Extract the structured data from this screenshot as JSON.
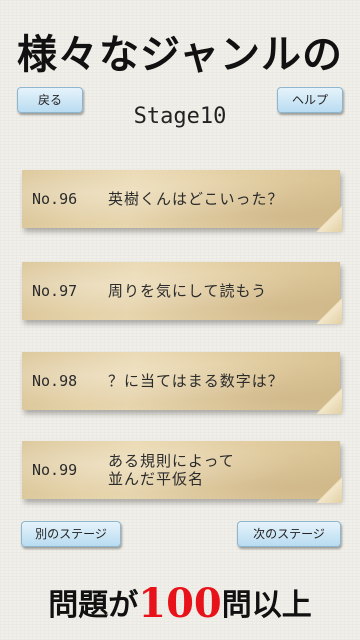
{
  "headline": "様々なジャンルの",
  "nav": {
    "back_label": "戻る",
    "help_label": "ヘルプ"
  },
  "stage_title": "Stage10",
  "questions": [
    {
      "number": "No.96",
      "title": "英樹くんはどこいった？"
    },
    {
      "number": "No.97",
      "title": "周りを気にして読もう"
    },
    {
      "number": "No.98",
      "title": "？に当てはまる数字は？"
    },
    {
      "number": "No.99",
      "title_line1": "ある規則によって",
      "title_line2": "並んだ平仮名"
    }
  ],
  "stage_nav": {
    "other_stage_label": "別のステージ",
    "next_stage_label": "次のステージ"
  },
  "footer": {
    "prefix": "問題が",
    "count": "100",
    "suffix": "問以上"
  },
  "colors": {
    "button_gradient_top": "#e6f3fb",
    "button_gradient_bottom": "#b9dcf1",
    "note_paper": "#e2cda1",
    "footer_accent": "#e8121a"
  }
}
